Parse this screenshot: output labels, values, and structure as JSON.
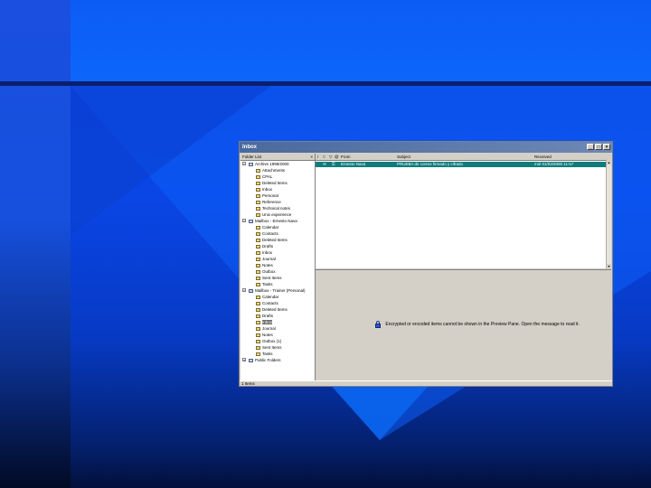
{
  "window": {
    "title": "Inbox",
    "min_glyph": "_",
    "max_glyph": "□",
    "close_glyph": "×"
  },
  "folder_pane": {
    "header": "Folder List",
    "close_glyph": "×",
    "items": [
      {
        "label": "Archive 1998/2000",
        "kind": "store",
        "expander": "−"
      },
      {
        "label": "Attachments",
        "kind": "folder"
      },
      {
        "label": "CPAL",
        "kind": "folder"
      },
      {
        "label": "Deleted Items",
        "kind": "folder"
      },
      {
        "label": "Inbox",
        "kind": "folder"
      },
      {
        "label": "Personal",
        "kind": "folder"
      },
      {
        "label": "Reference",
        "kind": "folder"
      },
      {
        "label": "Technical notes",
        "kind": "folder"
      },
      {
        "label": "Unix experience",
        "kind": "folder"
      },
      {
        "label": "Mailbox - Ernesto Nava",
        "kind": "store",
        "expander": "−"
      },
      {
        "label": "Calendar",
        "kind": "folder"
      },
      {
        "label": "Contacts",
        "kind": "folder"
      },
      {
        "label": "Deleted Items",
        "kind": "folder"
      },
      {
        "label": "Drafts",
        "kind": "folder"
      },
      {
        "label": "Inbox",
        "kind": "folder"
      },
      {
        "label": "Journal",
        "kind": "folder"
      },
      {
        "label": "Notes",
        "kind": "folder"
      },
      {
        "label": "Outbox",
        "kind": "folder"
      },
      {
        "label": "Sent Items",
        "kind": "folder"
      },
      {
        "label": "Tasks",
        "kind": "folder"
      },
      {
        "label": "Mailbox - Trainer (Personal)",
        "kind": "store",
        "expander": "−"
      },
      {
        "label": "Calendar",
        "kind": "folder"
      },
      {
        "label": "Contacts",
        "kind": "folder"
      },
      {
        "label": "Deleted Items",
        "kind": "folder"
      },
      {
        "label": "Drafts",
        "kind": "folder"
      },
      {
        "label": "Inbox",
        "kind": "folder",
        "selected": true
      },
      {
        "label": "Journal",
        "kind": "folder"
      },
      {
        "label": "Notes",
        "kind": "folder"
      },
      {
        "label": "Outbox (1)",
        "kind": "folder"
      },
      {
        "label": "Sent Items",
        "kind": "folder"
      },
      {
        "label": "Tasks",
        "kind": "folder"
      },
      {
        "label": "Public Folders",
        "kind": "store",
        "expander": "+"
      }
    ]
  },
  "message_list": {
    "columns": {
      "importance": "!",
      "type": "□",
      "flag": "▽",
      "attachment": "@",
      "from": "From",
      "subject": "Subject",
      "received": "Received"
    },
    "rows": [
      {
        "from": "Ernesto Nava",
        "subject": "PRUEBA de correo firmado y cifrado",
        "received": "mié 01/03/2000 11:57"
      }
    ]
  },
  "preview": {
    "message": "Encrypted or encoded items cannot be shown in the Preview Pane. Open the message to read it."
  },
  "status": {
    "text": "1 Items"
  },
  "colors": {
    "background_blue": "#0a46e6",
    "selected_row": "#0f7b7b",
    "window_face": "#d4d0c8"
  }
}
